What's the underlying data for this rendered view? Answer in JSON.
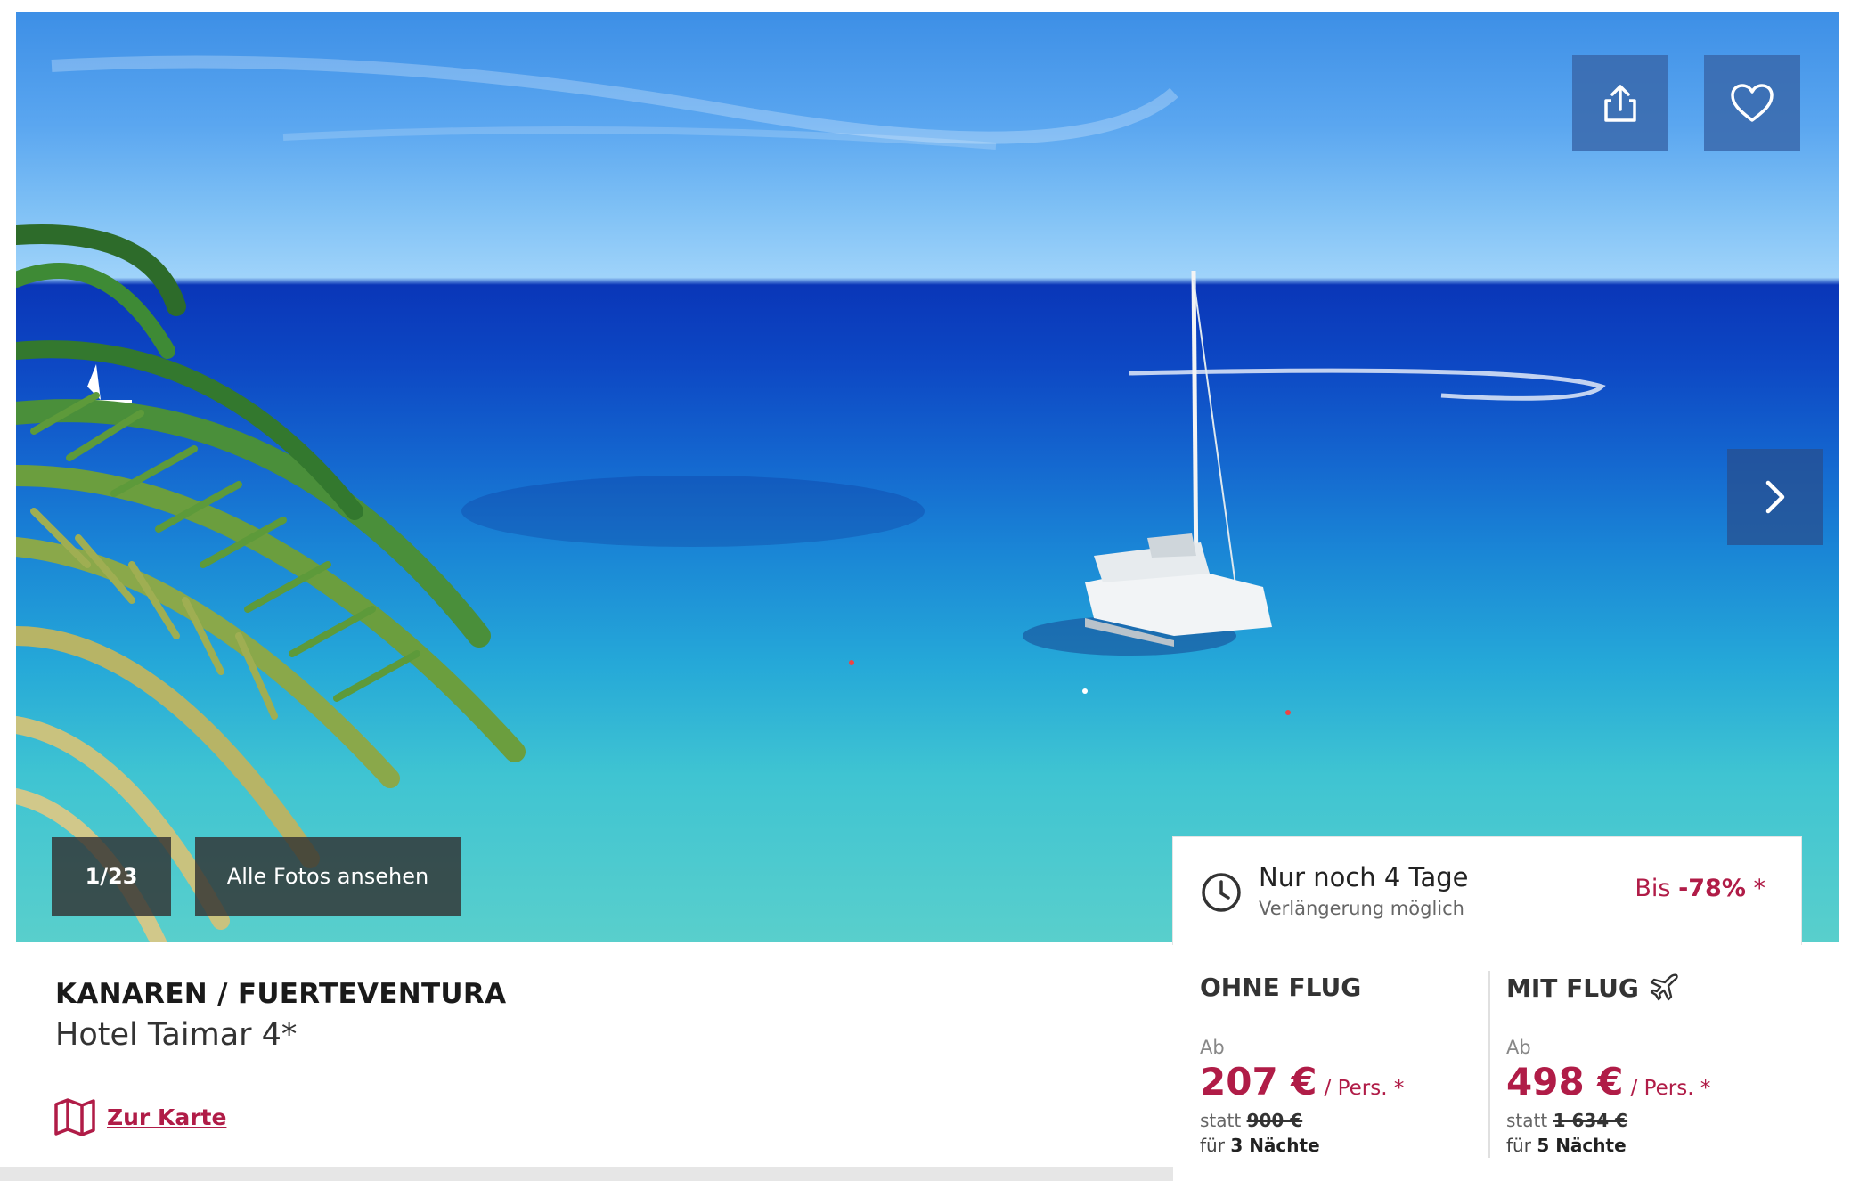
{
  "gallery": {
    "counter": "1/23",
    "all_photos_label": "Alle Fotos ansehen",
    "share_icon": "share-icon",
    "favorite_icon": "heart-icon",
    "next_icon": "chevron-right-icon"
  },
  "countdown": {
    "title": "Nur noch 4 Tage",
    "subtitle": "Verlängerung möglich",
    "discount_prefix": "Bis ",
    "discount_value": "-78%",
    "discount_suffix": " *"
  },
  "hotel": {
    "region": "KANAREN / FUERTEVENTURA",
    "name": "Hotel Taimar 4*",
    "map_link": "Zur Karte"
  },
  "offers": {
    "without_flight": {
      "title": "OHNE FLUG",
      "from": "Ab",
      "price": "207 €",
      "per": "/ Pers. *",
      "statt_label": "statt",
      "old_price": "900 €",
      "nights_prefix": "für",
      "nights": "3 Nächte"
    },
    "with_flight": {
      "title": "MIT FLUG",
      "from": "Ab",
      "price": "498 €",
      "per": "/ Pers. *",
      "statt_label": "statt",
      "old_price": "1 634 €",
      "nights_prefix": "für",
      "nights": "5 Nächte"
    }
  },
  "colors": {
    "accent": "#b01c47",
    "overlay_button": "#3866aa"
  }
}
